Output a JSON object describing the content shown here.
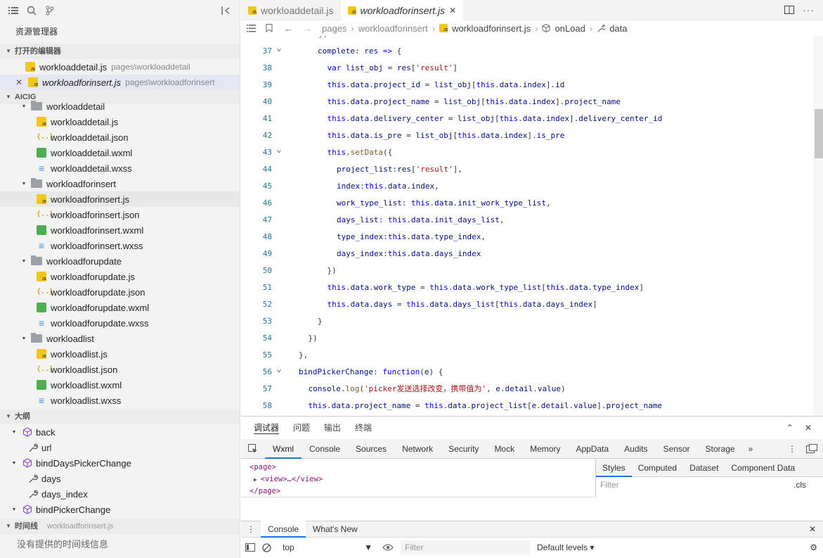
{
  "sidebar": {
    "title": "资源管理器",
    "open_editors_header": "打开的编辑器",
    "open_editors": [
      {
        "name": "workloaddetail.js",
        "dir": "pages\\workloaddetail",
        "active": false
      },
      {
        "name": "workloadforinsert.js",
        "dir": "pages\\workloadforinsert",
        "active": true
      }
    ],
    "project_header": "AICIG",
    "tree": [
      {
        "type": "folder",
        "name": "workloaddetail",
        "level": 1
      },
      {
        "type": "js",
        "name": "workloaddetail.js",
        "level": 2
      },
      {
        "type": "json",
        "name": "workloaddetail.json",
        "level": 2
      },
      {
        "type": "wxml",
        "name": "workloaddetail.wxml",
        "level": 2
      },
      {
        "type": "wxss",
        "name": "workloaddetail.wxss",
        "level": 2
      },
      {
        "type": "folder",
        "name": "workloadforinsert",
        "level": 1
      },
      {
        "type": "js",
        "name": "workloadforinsert.js",
        "level": 2,
        "selected": true
      },
      {
        "type": "json",
        "name": "workloadforinsert.json",
        "level": 2
      },
      {
        "type": "wxml",
        "name": "workloadforinsert.wxml",
        "level": 2
      },
      {
        "type": "wxss",
        "name": "workloadforinsert.wxss",
        "level": 2
      },
      {
        "type": "folder",
        "name": "workloadforupdate",
        "level": 1
      },
      {
        "type": "js",
        "name": "workloadforupdate.js",
        "level": 2
      },
      {
        "type": "json",
        "name": "workloadforupdate.json",
        "level": 2
      },
      {
        "type": "wxml",
        "name": "workloadforupdate.wxml",
        "level": 2
      },
      {
        "type": "wxss",
        "name": "workloadforupdate.wxss",
        "level": 2
      },
      {
        "type": "folder",
        "name": "workloadlist",
        "level": 1
      },
      {
        "type": "js",
        "name": "workloadlist.js",
        "level": 2
      },
      {
        "type": "json",
        "name": "workloadlist.json",
        "level": 2
      },
      {
        "type": "wxml",
        "name": "workloadlist.wxml",
        "level": 2
      },
      {
        "type": "wxss",
        "name": "workloadlist.wxss",
        "level": 2
      }
    ],
    "outline_header": "大纲",
    "outline": [
      {
        "kind": "method",
        "name": "back",
        "level": 1
      },
      {
        "kind": "prop",
        "name": "url",
        "level": 2
      },
      {
        "kind": "method",
        "name": "bindDaysPickerChange",
        "level": 1
      },
      {
        "kind": "prop",
        "name": "days",
        "level": 2
      },
      {
        "kind": "prop",
        "name": "days_index",
        "level": 2
      },
      {
        "kind": "method",
        "name": "bindPickerChange",
        "level": 1
      }
    ],
    "timeline_header": "时间线",
    "timeline_file": "workloadforinsert.js",
    "timeline_empty": "没有提供的时间线信息"
  },
  "tabs": [
    {
      "label": "workloaddetail.js",
      "active": false
    },
    {
      "label": "workloadforinsert.js",
      "active": true
    }
  ],
  "breadcrumb": [
    "pages",
    "workloadforinsert",
    "workloadforinsert.js",
    "onLoad",
    "data"
  ],
  "code_lines": [
    {
      "n": "37",
      "fold": true,
      "indent": 2,
      "text": "complete: res => {"
    },
    {
      "n": "38",
      "fold": false,
      "indent": 3,
      "text": "var list_obj = res['result']"
    },
    {
      "n": "39",
      "fold": false,
      "indent": 3,
      "text": "this.data.project_id = list_obj[this.data.index].id"
    },
    {
      "n": "40",
      "fold": false,
      "indent": 3,
      "text": "this.data.project_name = list_obj[this.data.index].project_name"
    },
    {
      "n": "41",
      "fold": false,
      "indent": 3,
      "text": "this.data.delivery_center = list_obj[this.data.index].delivery_center_id"
    },
    {
      "n": "42",
      "fold": false,
      "indent": 3,
      "text": "this.data.is_pre = list_obj[this.data.index].is_pre"
    },
    {
      "n": "43",
      "fold": true,
      "indent": 3,
      "text": "this.setData({"
    },
    {
      "n": "44",
      "fold": false,
      "indent": 4,
      "text": "project_list:res['result'],"
    },
    {
      "n": "45",
      "fold": false,
      "indent": 4,
      "text": "index:this.data.index,"
    },
    {
      "n": "46",
      "fold": false,
      "indent": 4,
      "text": "work_type_list: this.data.init_work_type_list,"
    },
    {
      "n": "47",
      "fold": false,
      "indent": 4,
      "text": "days_list: this.data.init_days_list,"
    },
    {
      "n": "48",
      "fold": false,
      "indent": 4,
      "text": "type_index:this.data.type_index,"
    },
    {
      "n": "49",
      "fold": false,
      "indent": 4,
      "text": "days_index:this.data.days_index"
    },
    {
      "n": "50",
      "fold": false,
      "indent": 3,
      "text": "})"
    },
    {
      "n": "51",
      "fold": false,
      "indent": 3,
      "text": "this.data.work_type = this.data.work_type_list[this.data.type_index]"
    },
    {
      "n": "52",
      "fold": false,
      "indent": 3,
      "text": "this.data.days = this.data.days_list[this.data.days_index]"
    },
    {
      "n": "53",
      "fold": false,
      "indent": 2,
      "text": "}"
    },
    {
      "n": "54",
      "fold": false,
      "indent": 1,
      "text": "})"
    },
    {
      "n": "55",
      "fold": false,
      "indent": 0,
      "text": "},"
    },
    {
      "n": "56",
      "fold": true,
      "indent": 0,
      "text": "bindPickerChange: function(e) {"
    },
    {
      "n": "57",
      "fold": false,
      "indent": 1,
      "text": "console.log('picker发送选择改变，携带值为', e.detail.value)"
    },
    {
      "n": "58",
      "fold": false,
      "indent": 1,
      "text": "this.data.project_name = this.data.project_list[e.detail.value].project_name"
    }
  ],
  "devtools": {
    "top_tabs": [
      "调试器",
      "问题",
      "输出",
      "终端"
    ],
    "tabs": [
      "Wxml",
      "Console",
      "Sources",
      "Network",
      "Security",
      "Mock",
      "Memory",
      "AppData",
      "Audits",
      "Sensor",
      "Storage"
    ],
    "active_tab": "Wxml",
    "wxml_lines": [
      "<page>",
      "<view>…</view>",
      "</page>"
    ],
    "styles_tabs": [
      "Styles",
      "Computed",
      "Dataset",
      "Component Data"
    ],
    "filter_placeholder": "Filter",
    "cls_label": ".cls",
    "console_tabs": [
      "Console",
      "What's New"
    ],
    "context": "top",
    "console_filter": "Filter",
    "levels": "Default levels"
  }
}
